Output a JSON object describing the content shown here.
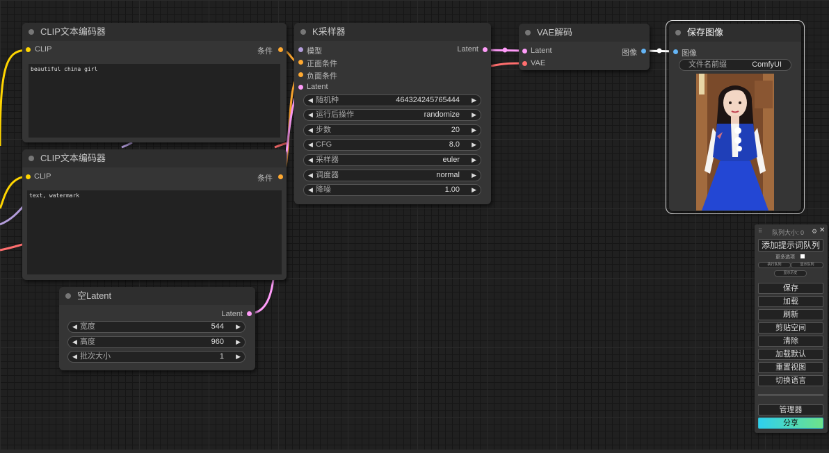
{
  "canvas": {
    "background": "#202020"
  },
  "colors": {
    "clip": "#ffd500",
    "conditioning": "#ffa931",
    "model": "#b39ddb",
    "latent": "#ff9cf9",
    "vae": "#ff6e6e",
    "image": "#64b5f6"
  },
  "clip_node_1": {
    "title": "CLIP文本编码器",
    "input_label": "CLIP",
    "output_label": "条件",
    "text": "beautiful china girl"
  },
  "clip_node_2": {
    "title": "CLIP文本编码器",
    "input_label": "CLIP",
    "output_label": "条件",
    "text": "text, watermark"
  },
  "ksampler": {
    "title": "K采样器",
    "inputs": [
      "模型",
      "正面条件",
      "负面条件",
      "Latent"
    ],
    "output_label": "Latent",
    "widgets": [
      {
        "label": "随机种",
        "value": "464324245765444"
      },
      {
        "label": "运行后操作",
        "value": "randomize"
      },
      {
        "label": "步数",
        "value": "20"
      },
      {
        "label": "CFG",
        "value": "8.0"
      },
      {
        "label": "采样器",
        "value": "euler"
      },
      {
        "label": "调度器",
        "value": "normal"
      },
      {
        "label": "降噪",
        "value": "1.00"
      }
    ]
  },
  "vae_decode": {
    "title": "VAE解码",
    "inputs": [
      "Latent",
      "VAE"
    ],
    "output_label": "图像"
  },
  "save_image": {
    "title": "保存图像",
    "input_label": "图像",
    "prefix_label": "文件名前缀",
    "prefix_value": "ComfyUI"
  },
  "empty_latent": {
    "title": "空Latent",
    "output_label": "Latent",
    "widgets": [
      {
        "label": "宽度",
        "value": "544"
      },
      {
        "label": "高度",
        "value": "960"
      },
      {
        "label": "批次大小",
        "value": "1"
      }
    ]
  },
  "side_panel": {
    "queue_label": "队列大小: 0",
    "add_queue": "添加提示词队列",
    "more_options": "更多选项",
    "small_buttons": [
      "执行队列",
      "显示队列",
      "显示历史"
    ],
    "buttons": [
      "保存",
      "加载",
      "刷新",
      "剪贴空间",
      "清除",
      "加载默认",
      "重置视图",
      "切换语言"
    ],
    "manager": "管理器",
    "share": "分享"
  }
}
